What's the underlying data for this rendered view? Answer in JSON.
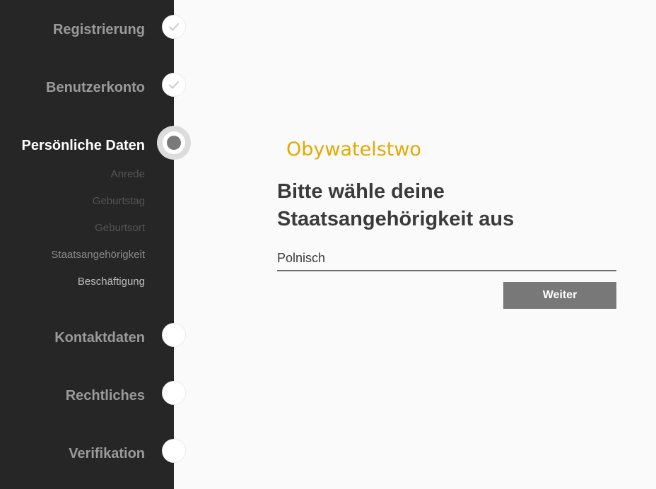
{
  "sidebar": {
    "steps": [
      {
        "label": "Registrierung",
        "state": "done"
      },
      {
        "label": "Benutzerkonto",
        "state": "done"
      },
      {
        "label": "Persönliche Daten",
        "state": "active",
        "substeps": [
          "Anrede",
          "Geburtstag",
          "Geburtsort",
          "Staatsangehörigkeit",
          "Beschäftigung"
        ]
      },
      {
        "label": "Kontaktdaten",
        "state": "pending"
      },
      {
        "label": "Rechtliches",
        "state": "pending"
      },
      {
        "label": "Verifikation",
        "state": "pending"
      }
    ]
  },
  "main": {
    "overlay_label": "Obywatelstwo",
    "question_line1": "Bitte wähle deine",
    "question_line2": "Staatsangehörigkeit aus",
    "nationality_value": "Polnisch",
    "next_label": "Weiter"
  },
  "colors": {
    "sidebar_bg": "#262626",
    "overlay_label": "#e6a800",
    "button_bg": "#787878"
  }
}
